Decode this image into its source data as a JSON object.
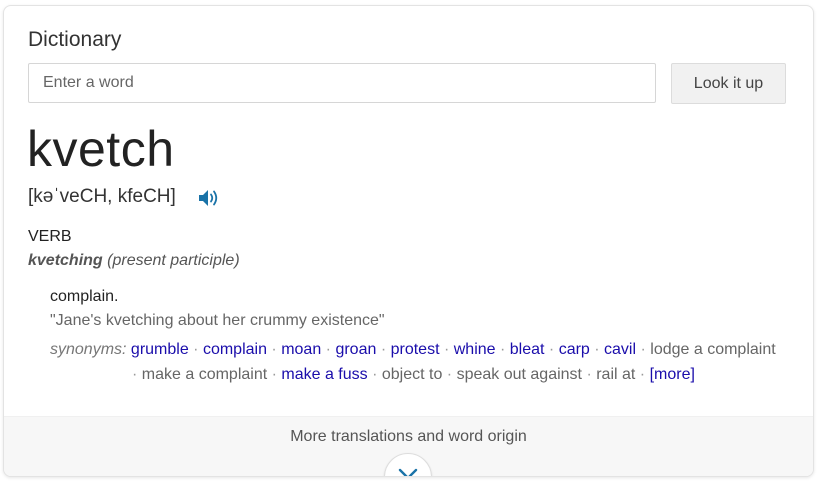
{
  "card": {
    "title": "Dictionary"
  },
  "search": {
    "placeholder": "Enter a word",
    "value": "",
    "button_label": "Look it up"
  },
  "entry": {
    "headword": "kvetch",
    "pronunciation": "[kəˈveCH, kfeCH]",
    "part_of_speech": "VERB",
    "inflection_form": "kvetching",
    "inflection_note": "(present participle)",
    "definition": "complain.",
    "example": "\"Jane's kvetching about her crummy existence\"",
    "synonyms_label": "synonyms:",
    "synonyms": [
      {
        "text": "grumble",
        "link": true
      },
      {
        "text": "complain",
        "link": true
      },
      {
        "text": "moan",
        "link": true
      },
      {
        "text": "groan",
        "link": true
      },
      {
        "text": "protest",
        "link": true
      },
      {
        "text": "whine",
        "link": true
      },
      {
        "text": "bleat",
        "link": true
      },
      {
        "text": "carp",
        "link": true
      },
      {
        "text": "cavil",
        "link": true
      },
      {
        "text": "lodge a complaint",
        "link": false
      },
      {
        "text": "make a complaint",
        "link": false
      },
      {
        "text": "make a fuss",
        "link": true
      },
      {
        "text": "object to",
        "link": false
      },
      {
        "text": "speak out against",
        "link": false
      },
      {
        "text": "rail at",
        "link": false
      }
    ],
    "more_link": "[more]"
  },
  "footer": {
    "more_label": "More translations and word origin"
  },
  "icons": {
    "speaker": "speaker-icon",
    "expand": "chevron-down-icon"
  },
  "colors": {
    "link": "#1a0dab",
    "speaker": "#1a73a8",
    "chevron": "#1a73a8"
  }
}
